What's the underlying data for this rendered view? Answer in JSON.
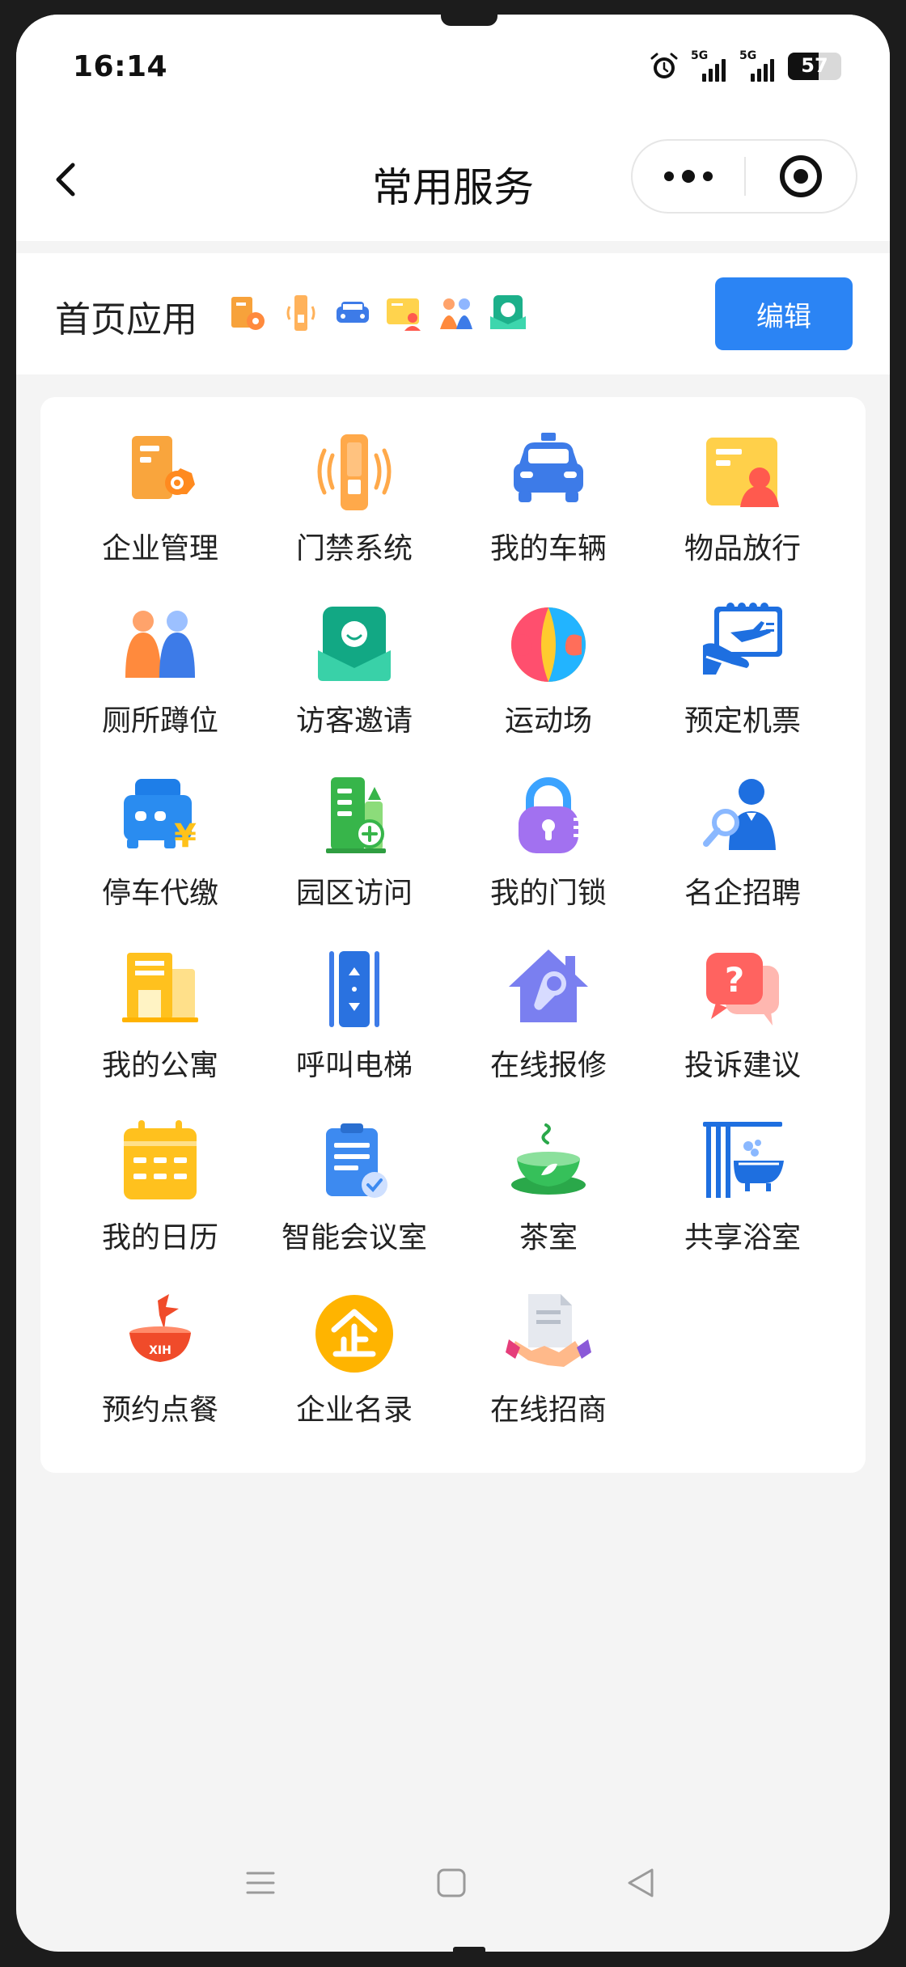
{
  "status_bar": {
    "time": "16:14",
    "signal_1": "5G",
    "signal_2": "5G",
    "battery": "57"
  },
  "nav": {
    "title": "常用服务"
  },
  "home_apps": {
    "label": "首页应用",
    "edit_label": "编辑",
    "mini_icons": [
      "building-gear-icon",
      "door-access-icon",
      "car-icon",
      "id-card-icon",
      "people-icon",
      "visitor-icon"
    ]
  },
  "services": [
    {
      "label": "企业管理",
      "icon": "building-gear-icon"
    },
    {
      "label": "门禁系统",
      "icon": "door-access-icon"
    },
    {
      "label": "我的车辆",
      "icon": "car-icon"
    },
    {
      "label": "物品放行",
      "icon": "id-card-icon"
    },
    {
      "label": "厕所蹲位",
      "icon": "people-icon"
    },
    {
      "label": "访客邀请",
      "icon": "visitor-icon"
    },
    {
      "label": "运动场",
      "icon": "ball-icon"
    },
    {
      "label": "预定机票",
      "icon": "plane-ticket-icon"
    },
    {
      "label": "停车代缴",
      "icon": "parking-pay-icon"
    },
    {
      "label": "园区访问",
      "icon": "park-visit-icon"
    },
    {
      "label": "我的门锁",
      "icon": "lock-icon"
    },
    {
      "label": "名企招聘",
      "icon": "recruit-icon"
    },
    {
      "label": "我的公寓",
      "icon": "apartment-icon"
    },
    {
      "label": "呼叫电梯",
      "icon": "elevator-icon"
    },
    {
      "label": "在线报修",
      "icon": "repair-icon"
    },
    {
      "label": "投诉建议",
      "icon": "complaint-icon"
    },
    {
      "label": "我的日历",
      "icon": "calendar-icon"
    },
    {
      "label": "智能会议室",
      "icon": "meeting-room-icon"
    },
    {
      "label": "茶室",
      "icon": "tea-icon"
    },
    {
      "label": "共享浴室",
      "icon": "bathroom-icon"
    },
    {
      "label": "预约点餐",
      "icon": "food-order-icon"
    },
    {
      "label": "企业名录",
      "icon": "enterprise-directory-icon"
    },
    {
      "label": "在线招商",
      "icon": "investment-icon"
    }
  ],
  "colors": {
    "accent": "#2b84f4",
    "background": "#f4f4f4"
  }
}
